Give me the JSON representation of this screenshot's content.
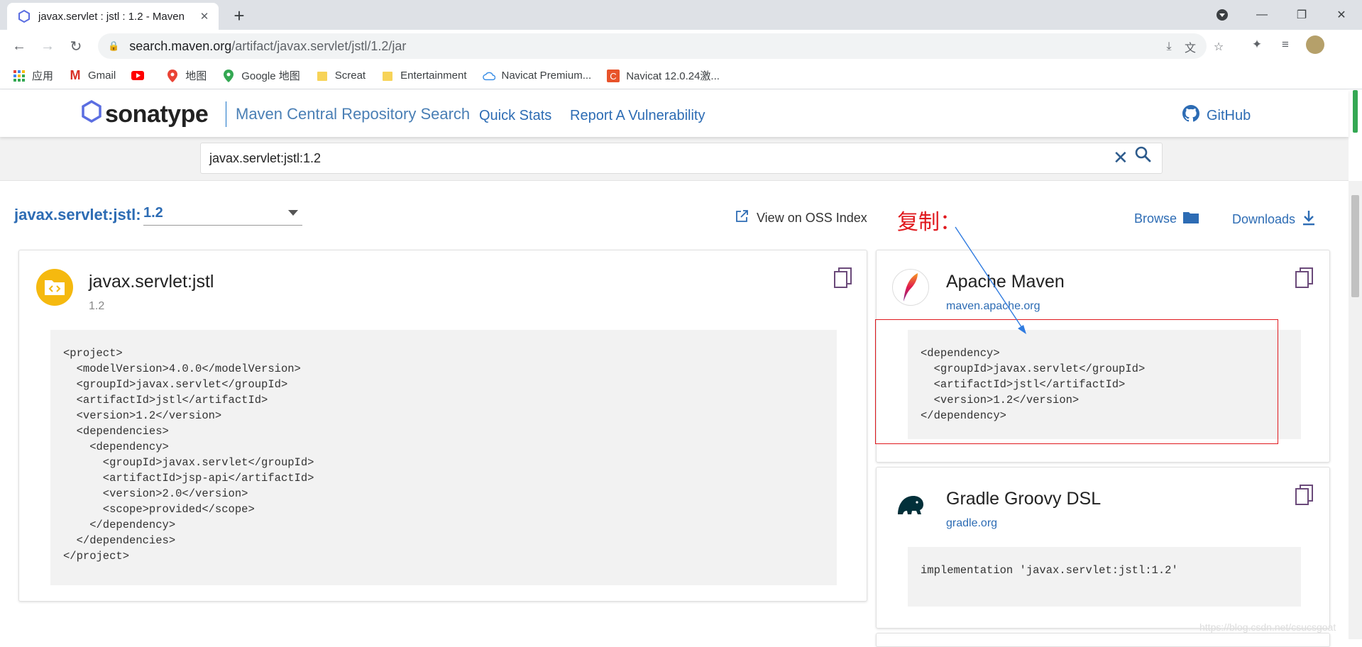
{
  "browser": {
    "tab_title": "javax.servlet : jstl : 1.2 - Maven",
    "url_host": "search.maven.org",
    "url_path": "/artifact/javax.servlet/jstl/1.2/jar"
  },
  "bookmarks": [
    {
      "label": "应用",
      "icon": "apps-grid-icon"
    },
    {
      "label": "Gmail",
      "icon": "gmail-icon"
    },
    {
      "label": "",
      "icon": "youtube-icon"
    },
    {
      "label": "地图",
      "icon": "maps-pin-icon"
    },
    {
      "label": "Google 地图",
      "icon": "maps-pin-icon"
    },
    {
      "label": "Screat",
      "icon": "folder-icon"
    },
    {
      "label": "Entertainment",
      "icon": "folder-icon"
    },
    {
      "label": "Navicat Premium...",
      "icon": "cloud-icon"
    },
    {
      "label": "Navicat 12.0.24激...",
      "icon": "navicat-icon"
    }
  ],
  "header": {
    "logo": "sonatype",
    "repo_title": "Maven Central Repository Search",
    "nav": [
      "Quick Stats",
      "Report A Vulnerability"
    ],
    "github": "GitHub"
  },
  "search": {
    "value": "javax.servlet:jstl:1.2"
  },
  "artifact": {
    "label": "javax.servlet:jstl:",
    "version": "1.2",
    "oss_link": "View on OSS Index",
    "browse": "Browse",
    "downloads": "Downloads",
    "annotation": "复制："
  },
  "cards": {
    "pom": {
      "title": "javax.servlet:jstl",
      "subtitle": "1.2",
      "code": "<project>\n  <modelVersion>4.0.0</modelVersion>\n  <groupId>javax.servlet</groupId>\n  <artifactId>jstl</artifactId>\n  <version>1.2</version>\n  <dependencies>\n    <dependency>\n      <groupId>javax.servlet</groupId>\n      <artifactId>jsp-api</artifactId>\n      <version>2.0</version>\n      <scope>provided</scope>\n    </dependency>\n  </dependencies>\n</project>"
    },
    "maven": {
      "title": "Apache Maven",
      "subtitle": "maven.apache.org",
      "code": "<dependency>\n  <groupId>javax.servlet</groupId>\n  <artifactId>jstl</artifactId>\n  <version>1.2</version>\n</dependency>"
    },
    "gradle": {
      "title": "Gradle Groovy DSL",
      "subtitle": "gradle.org",
      "code": "implementation 'javax.servlet:jstl:1.2'"
    }
  },
  "watermark": "https://blog.csdn.net/csucsgoat",
  "colors": {
    "link_blue": "#2d6cb4",
    "annotation_red": "#e0191e",
    "copy_purple": "#6b4a7a"
  }
}
